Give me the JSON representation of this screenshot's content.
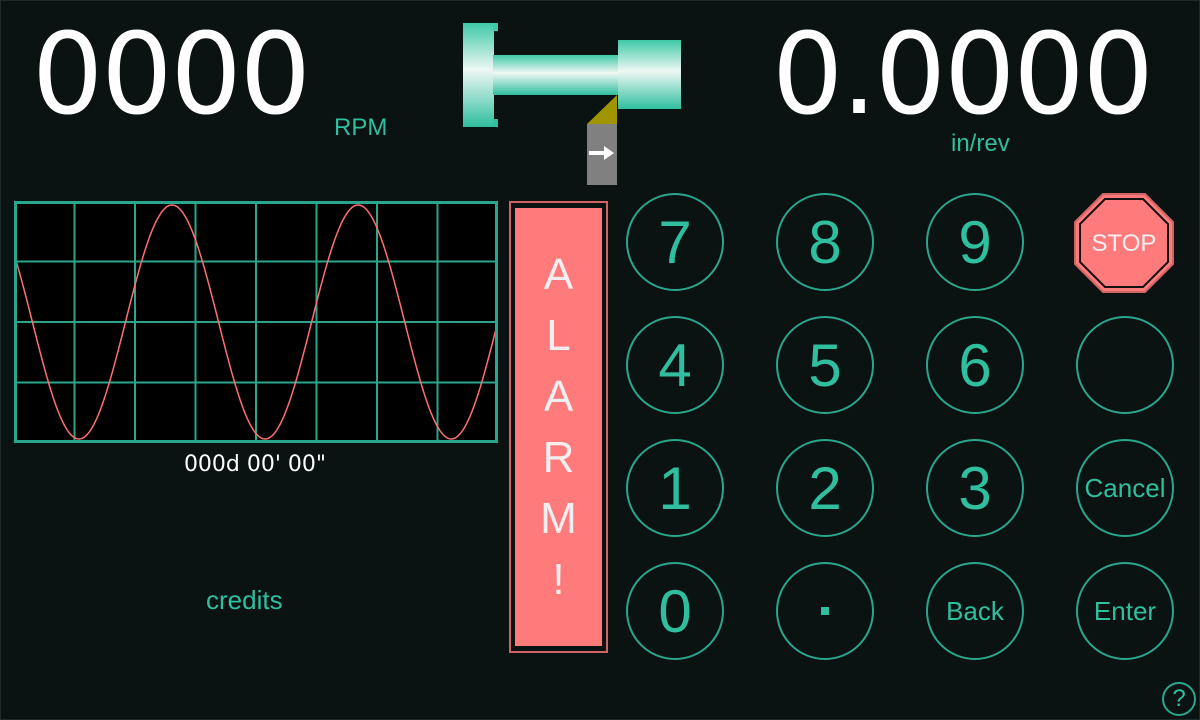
{
  "readouts": {
    "spindle_speed": {
      "value": "0000",
      "unit": "RPM"
    },
    "feed_rate": {
      "value": "0.0000",
      "unit": "in/rev"
    },
    "angle": "000d 00' 00\""
  },
  "lathe_graphic": {
    "tool_direction": "right",
    "colors": {
      "workpiece": "#3ec9a7",
      "tool_tip": "#a09400",
      "tool_holder": "#808080"
    }
  },
  "waveform": {
    "type": "line",
    "shape": "cosine",
    "cycles_visible": 2.6,
    "grid": {
      "columns": 8,
      "rows": 4
    },
    "colors": {
      "grid": "#2aa68c",
      "trace": "#ff6f6f",
      "background": "#000000"
    }
  },
  "alarm": {
    "label": "ALARM!",
    "letters": [
      "A",
      "L",
      "A",
      "R",
      "M",
      "!"
    ],
    "color": "#ff7b7b"
  },
  "keypad": {
    "keys": [
      {
        "id": "7",
        "label": "7",
        "kind": "digit"
      },
      {
        "id": "8",
        "label": "8",
        "kind": "digit"
      },
      {
        "id": "9",
        "label": "9",
        "kind": "digit"
      },
      {
        "id": "stop",
        "label": "STOP",
        "kind": "stop"
      },
      {
        "id": "4",
        "label": "4",
        "kind": "digit"
      },
      {
        "id": "5",
        "label": "5",
        "kind": "digit"
      },
      {
        "id": "6",
        "label": "6",
        "kind": "digit"
      },
      {
        "id": "blank",
        "label": "",
        "kind": "blank"
      },
      {
        "id": "1",
        "label": "1",
        "kind": "digit"
      },
      {
        "id": "2",
        "label": "2",
        "kind": "digit"
      },
      {
        "id": "3",
        "label": "3",
        "kind": "digit"
      },
      {
        "id": "cancel",
        "label": "Cancel",
        "kind": "word"
      },
      {
        "id": "0",
        "label": "0",
        "kind": "digit"
      },
      {
        "id": "decimal",
        "label": ".",
        "kind": "dot"
      },
      {
        "id": "back",
        "label": "Back",
        "kind": "word"
      },
      {
        "id": "enter",
        "label": "Enter",
        "kind": "word"
      }
    ]
  },
  "links": {
    "credits": "credits",
    "help": "?"
  },
  "theme": {
    "background": "#0b1212",
    "accent": "#2fbf9f",
    "alarm": "#ff7b7b",
    "text": "#ffffff"
  }
}
